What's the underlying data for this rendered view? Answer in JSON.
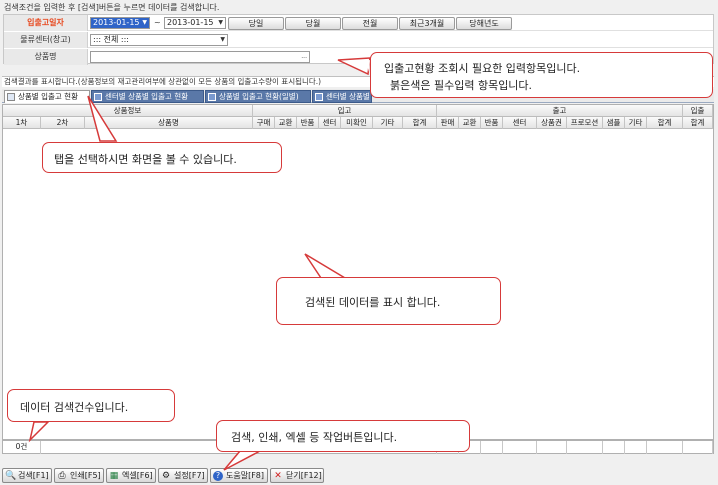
{
  "header": {
    "search_hint": "검색조건을 입력한 후 [검색]버튼을 누르면 데이터를 검색합니다."
  },
  "form": {
    "date_label": "입출고일자",
    "date_from": "2013-01-15",
    "date_sep": "~",
    "date_to": "2013-01-15",
    "quick_buttons": [
      "당일",
      "당월",
      "전월",
      "최근3개월",
      "당해년도"
    ],
    "center_label": "물류센터(창고)",
    "center_value": "::: 전체 :::",
    "product_label": "상품명",
    "product_btn": "..."
  },
  "result_hint": "검색결과를 표시합니다.(상품정보의 재고관리여부에 상관없이 모든 상품의 입출고수량이 표시됩니다.)",
  "tabs": [
    "상품별 입출고 현황",
    "센터별 상품별 입출고 현황",
    "상품별 입출고 현황(일별)",
    "센터별 상품별"
  ],
  "grid": {
    "group_headers": [
      "상품정보",
      "입고",
      "출고",
      "입출"
    ],
    "columns": [
      "1차",
      "2차",
      "상품명",
      "구매",
      "교환",
      "반품",
      "센터",
      "미확인",
      "기타",
      "합계",
      "판매",
      "교환",
      "반품",
      "센터",
      "상품권",
      "프로모션",
      "샘플",
      "기타",
      "합계",
      "합계"
    ]
  },
  "footer": {
    "count": "0건"
  },
  "buttons": [
    {
      "label": "검색[F1]",
      "icon": "search-icon"
    },
    {
      "label": "인쇄[F5]",
      "icon": "print-icon"
    },
    {
      "label": "엑셀[F6]",
      "icon": "excel-icon"
    },
    {
      "label": "설정[F7]",
      "icon": "gear-icon"
    },
    {
      "label": "도움말[F8]",
      "icon": "help-icon"
    },
    {
      "label": "닫기[F12]",
      "icon": "close-icon"
    }
  ],
  "tooltips": {
    "required_fields": "입출고현황 조회시 필요한 입력항목입니다.",
    "required_fields_2": "붉은색은 필수입력 항목입니다.",
    "tabs": "탭을 선택하시면 화면을 볼 수 있습니다.",
    "data": "검색된 데이터를 표시 합니다.",
    "count": "데이터 검색건수입니다.",
    "buttons": "검색, 인쇄, 엑셀 등 작업버튼입니다."
  },
  "colors": {
    "tooltip_border": "#d63a3a",
    "required_label": "#e8481e",
    "tab_inactive": "#5a78a8",
    "date_selected": "#2f64c8"
  }
}
